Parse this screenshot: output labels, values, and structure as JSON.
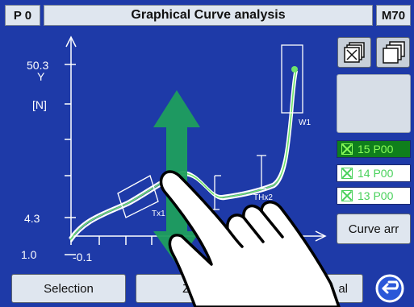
{
  "header": {
    "program_label": "P 0",
    "title": "Graphical Curve analysis",
    "mode_label": "M70"
  },
  "plot": {
    "y_max_label": "50.3",
    "y_axis_label": "Y",
    "y_unit_label": "[N]",
    "y_mid_label": "4.3",
    "y_min_label": "1.0",
    "x_min_label": "-0.1",
    "window_labels": {
      "tx1": "Tx1",
      "w1": "W1",
      "thx2": "THx2"
    }
  },
  "sidebar": {
    "curve_items": [
      {
        "label": "15 P00",
        "state": "active"
      },
      {
        "label": "14 P00",
        "state": "inactive"
      },
      {
        "label": "13 P00",
        "state": "inactive"
      }
    ],
    "curve_arr_label": "Curve arr"
  },
  "bottom": {
    "selection_label": "Selection",
    "zoom_label": "Zoo",
    "third_label": "al"
  },
  "icons": {
    "select_all": "select-all-icon",
    "copy": "copy-icon",
    "back": "back-icon",
    "hand": "hand-pointer-icon",
    "arrow": "vertical-double-arrow-icon"
  },
  "colors": {
    "background": "#1e3aa8",
    "curve": "#ffffff",
    "curve_active": "#6ee36a",
    "accent_green": "#1f9e5d"
  }
}
